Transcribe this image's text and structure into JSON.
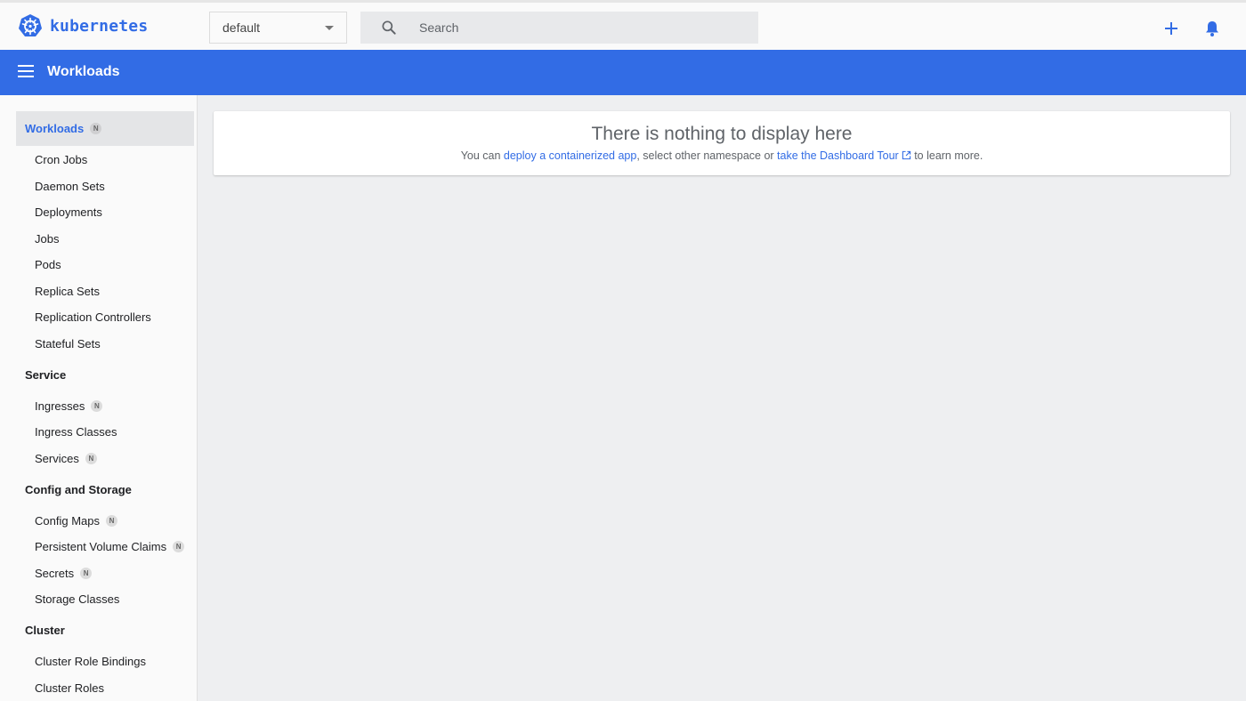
{
  "header": {
    "brand": "kubernetes",
    "namespace": "default",
    "search_placeholder": "Search"
  },
  "toolbar": {
    "title": "Workloads"
  },
  "sidebar": {
    "workloads": {
      "label": "Workloads",
      "badge": "N"
    },
    "cron_jobs": "Cron Jobs",
    "daemon_sets": "Daemon Sets",
    "deployments": "Deployments",
    "jobs": "Jobs",
    "pods": "Pods",
    "replica_sets": "Replica Sets",
    "replication_controllers": "Replication Controllers",
    "stateful_sets": "Stateful Sets",
    "service_section": "Service",
    "ingresses": {
      "label": "Ingresses",
      "badge": "N"
    },
    "ingress_classes": "Ingress Classes",
    "services": {
      "label": "Services",
      "badge": "N"
    },
    "config_section": "Config and Storage",
    "config_maps": {
      "label": "Config Maps",
      "badge": "N"
    },
    "pvcs": {
      "label": "Persistent Volume Claims",
      "badge": "N"
    },
    "secrets": {
      "label": "Secrets",
      "badge": "N"
    },
    "storage_classes": "Storage Classes",
    "cluster_section": "Cluster",
    "cluster_role_bindings": "Cluster Role Bindings",
    "cluster_roles": "Cluster Roles"
  },
  "main": {
    "title": "There is nothing to display here",
    "text_1": "You can ",
    "link_deploy": "deploy a containerized app",
    "text_2": ", select other namespace or ",
    "link_tour": "take the Dashboard Tour",
    "text_3": " to learn more."
  },
  "colors": {
    "accent": "#326ce5",
    "toolbar_bg": "#326ce5",
    "content_bg": "#eeeff1"
  },
  "icons": {
    "brand": "kubernetes-helm-icon",
    "search": "search-icon",
    "add": "plus-icon",
    "notifications": "bell-icon",
    "menu": "hamburger-menu-icon",
    "external": "external-link-icon"
  }
}
